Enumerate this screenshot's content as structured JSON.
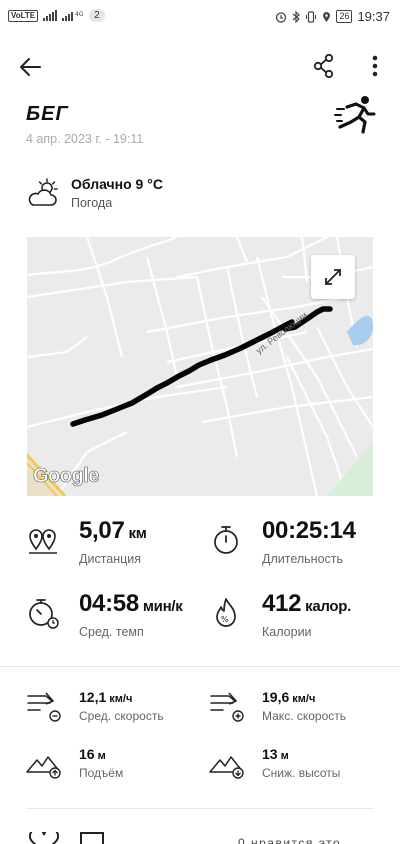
{
  "status_bar": {
    "volte": "VoLTE",
    "sim_badge": "2",
    "battery": "26",
    "time": "19:37"
  },
  "header": {
    "title": "БЕГ",
    "datetime": "4 апр. 2023 г. - 19:11"
  },
  "weather": {
    "summary": "Облачно 9 °C",
    "label": "Погода",
    "icon": "cloud-sun-icon"
  },
  "map": {
    "street_label": "ул. Революции",
    "attribution": "Google"
  },
  "main_stats": [
    {
      "value": "5,07",
      "unit": "км",
      "label": "Дистанция",
      "icon": "distance-icon"
    },
    {
      "value": "00:25:14",
      "unit": "",
      "label": "Длительность",
      "icon": "stopwatch-icon"
    },
    {
      "value": "04:58",
      "unit": "мин/к",
      "label": "Сред. темп",
      "icon": "pace-icon"
    },
    {
      "value": "412",
      "unit": "калор.",
      "label": "Калории",
      "icon": "calories-icon"
    }
  ],
  "detail_stats": [
    {
      "value": "12,1",
      "unit": "км/ч",
      "label": "Сред. скорость",
      "icon": "avg-speed-icon"
    },
    {
      "value": "19,6",
      "unit": "км/ч",
      "label": "Макс. скорость",
      "icon": "max-speed-icon"
    },
    {
      "value": "16",
      "unit": "м",
      "label": "Подъём",
      "icon": "ascent-icon"
    },
    {
      "value": "13",
      "unit": "м",
      "label": "Сниж. высоты",
      "icon": "descent-icon"
    }
  ],
  "bottom": {
    "likes_text": "0 нравится это"
  }
}
